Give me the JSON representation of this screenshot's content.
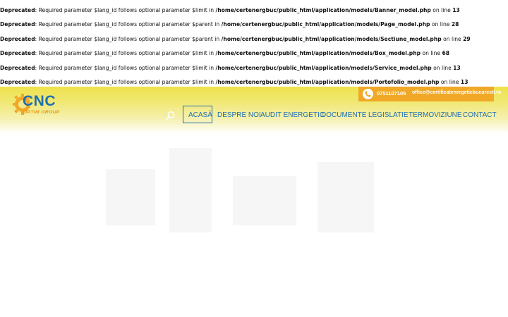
{
  "notices": [
    {
      "level": "Deprecated",
      "message": ": Required parameter $lang_id follows optional parameter $limit in ",
      "path": "/home/certenergbuc/public_html/application/models/Banner_model.php",
      "online": " on line ",
      "line": "13"
    },
    {
      "level": "Deprecated",
      "message": ": Required parameter $lang_id follows optional parameter $parent in ",
      "path": "/home/certenergbuc/public_html/application/models/Page_model.php",
      "online": " on line ",
      "line": "28"
    },
    {
      "level": "Deprecated",
      "message": ": Required parameter $lang_id follows optional parameter $parent in ",
      "path": "/home/certenergbuc/public_html/application/models/Sectiune_model.php",
      "online": " on line ",
      "line": "29"
    },
    {
      "level": "Deprecated",
      "message": ": Required parameter $lang_id follows optional parameter $limit in ",
      "path": "/home/certenergbuc/public_html/application/models/Box_model.php",
      "online": " on line ",
      "line": "68"
    },
    {
      "level": "Deprecated",
      "message": ": Required parameter $lang_id follows optional parameter $limit in ",
      "path": "/home/certenergbuc/public_html/application/models/Service_model.php",
      "online": " on line ",
      "line": "13"
    },
    {
      "level": "Deprecated",
      "message": ": Required parameter $lang_id follows optional parameter $limit in ",
      "path": "/home/certenergbuc/public_html/application/models/Portofolio_model.php",
      "online": " on line ",
      "line": "13"
    }
  ],
  "logo": {
    "main": "CNC",
    "sub": "OPTIM GROUP"
  },
  "contact": {
    "phone": "0751107105",
    "email": "office@certificatenergeticbucuresti.ro"
  },
  "nav": {
    "acasa": "ACASĂ",
    "despre": "DESPRE NOI",
    "audit": "AUDIT ENERGETIC",
    "documente": "DOCUMENTE",
    "legislatie": "LEGISLATIE",
    "termoviziune": "TERMOVIZIUNE",
    "contact": "CONTACT"
  },
  "colors": {
    "brand_blue": "#1f6fb0",
    "brand_orange": "#f0a826",
    "header_yellow": "#eee24a"
  },
  "icons": {
    "search": "search-icon",
    "phone": "phone-icon",
    "logo_gear": "gear-icon"
  }
}
